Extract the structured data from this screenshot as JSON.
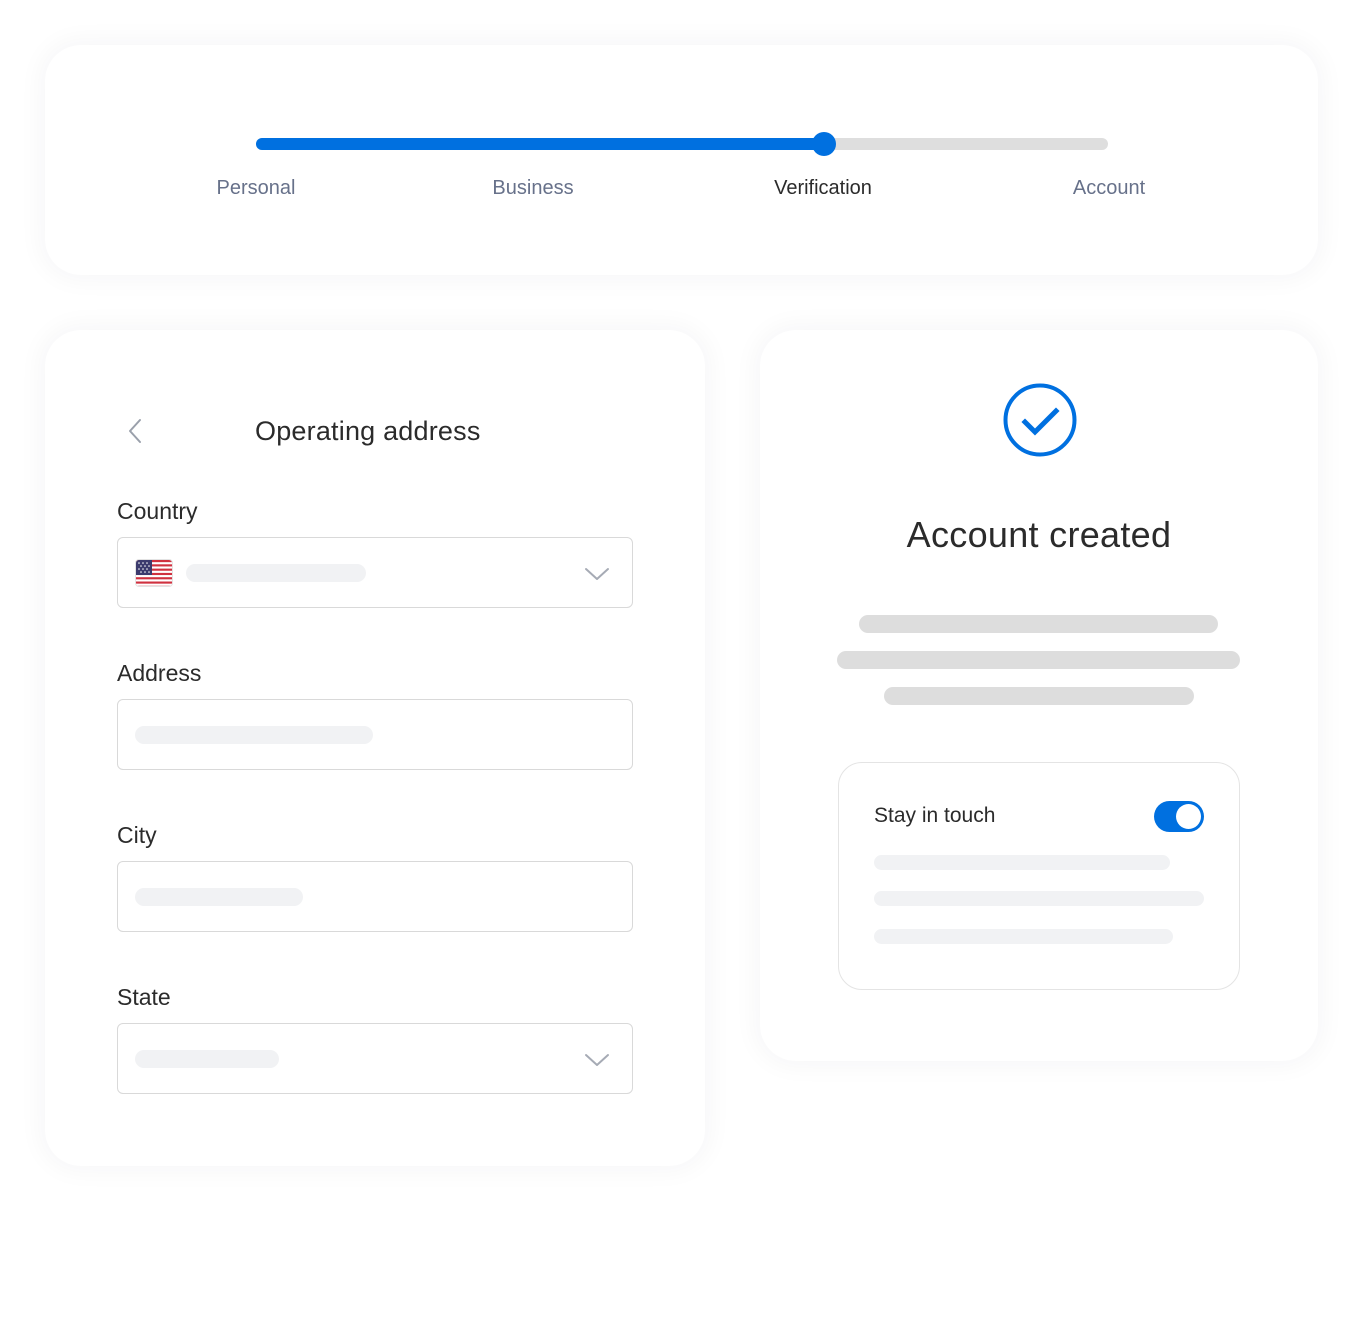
{
  "stepper": {
    "steps": [
      {
        "label": "Personal",
        "state": "complete"
      },
      {
        "label": "Business",
        "state": "complete"
      },
      {
        "label": "Verification",
        "state": "current"
      },
      {
        "label": "Account",
        "state": "upcoming"
      }
    ],
    "progress_fraction": 0.667,
    "colors": {
      "fill": "#0070e0",
      "track": "#dedede",
      "active_label": "#2b2b2b",
      "inactive_label": "#67718a"
    }
  },
  "address_form": {
    "title": "Operating address",
    "back_icon": "chevron-left-icon",
    "fields": [
      {
        "label": "Country",
        "type": "select",
        "value": "",
        "flag_icon": "us-flag-icon"
      },
      {
        "label": "Address",
        "type": "text",
        "value": ""
      },
      {
        "label": "City",
        "type": "text",
        "value": ""
      },
      {
        "label": "State",
        "type": "select",
        "value": ""
      }
    ]
  },
  "success": {
    "icon": "check-circle-icon",
    "title": "Account created",
    "accent": "#0070e0",
    "stay_in_touch": {
      "label": "Stay in touch",
      "toggle_on": true
    }
  }
}
